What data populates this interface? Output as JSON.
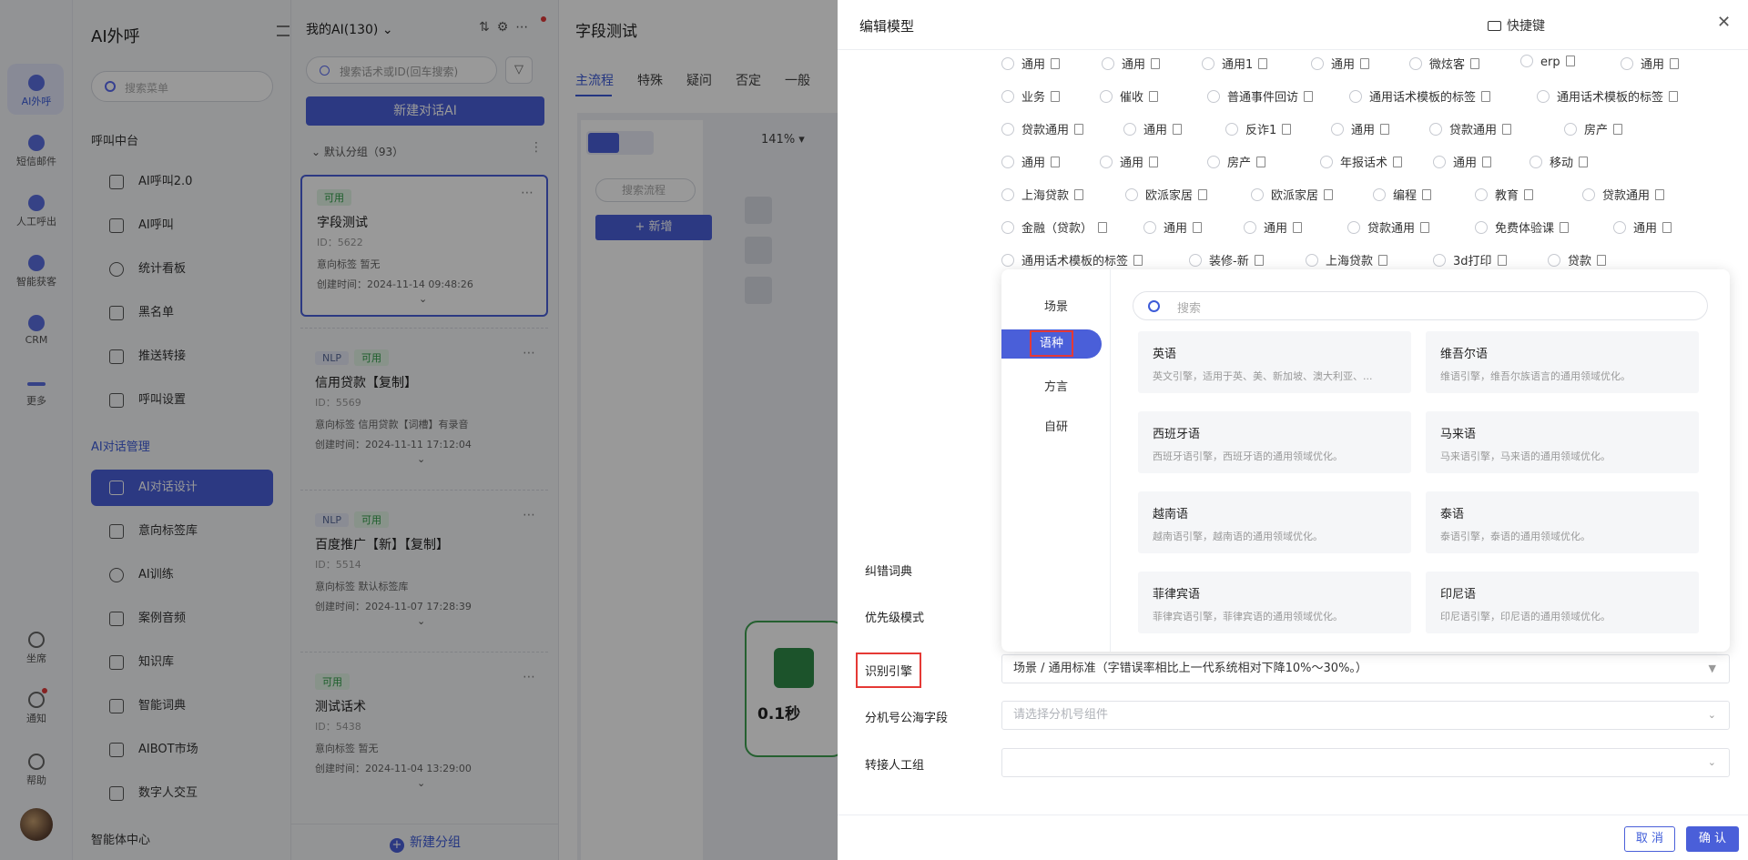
{
  "rail": {
    "items": [
      {
        "label": "AI外呼",
        "icon": "ai-call-icon"
      },
      {
        "label": "短信邮件",
        "icon": "message-icon"
      },
      {
        "label": "人工呼出",
        "icon": "phone-icon"
      },
      {
        "label": "智能获客",
        "icon": "target-icon"
      },
      {
        "label": "CRM",
        "icon": "crm-icon"
      },
      {
        "label": "更多",
        "icon": "more-icon"
      }
    ],
    "bottom": [
      {
        "label": "坐席",
        "icon": "headset-icon"
      },
      {
        "label": "通知",
        "icon": "bell-icon"
      },
      {
        "label": "帮助",
        "icon": "help-icon"
      }
    ]
  },
  "menu": {
    "title": "AI外呼",
    "search_placeholder": "搜索菜单",
    "section1": "呼叫中台",
    "section1_items": [
      "AI呼叫2.0",
      "AI呼叫",
      "统计看板",
      "黑名单",
      "推送转接",
      "呼叫设置"
    ],
    "section2": "AI对话管理",
    "section2_items": [
      "AI对话设计",
      "意向标签库",
      "AI训练",
      "案例音频",
      "知识库",
      "智能词典",
      "AIBOT市场",
      "数字人交互"
    ],
    "section3": "智能体中心"
  },
  "list": {
    "header": "我的AI(130)",
    "header_chevron": "⌄",
    "search_placeholder": "搜索话术或ID(回车搜索)",
    "new_button": "新建对话AI",
    "group": "默认分组（93）",
    "group_dots": "⋮",
    "cards": [
      {
        "badges": [
          "可用"
        ],
        "title": "字段测试",
        "id": "ID：5622",
        "tag": "意向标签    暂无",
        "time": "创建时间：2024-11-14 09:48:26"
      },
      {
        "badges": [
          "NLP",
          "可用"
        ],
        "title": "信用贷款【复制】",
        "id": "ID：5569",
        "tag": "意向标签    信用贷款【词槽】有录音",
        "time": "创建时间：2024-11-11 17:12:04"
      },
      {
        "badges": [
          "NLP",
          "可用"
        ],
        "title": "百度推广【新】【复制】",
        "id": "ID：5514",
        "tag": "意向标签    默认标签库",
        "time": "创建时间：2024-11-07 17:28:39"
      },
      {
        "badges": [
          "可用"
        ],
        "title": "测试话术",
        "id": "ID：5438",
        "tag": "意向标签    暂无",
        "time": "创建时间：2024-11-04 13:29:00"
      }
    ],
    "new_group": "新建分组"
  },
  "main": {
    "title": "字段测试",
    "tabs": [
      "主流程",
      "特殊",
      "疑问",
      "否定",
      "一般"
    ],
    "zoom": "141%",
    "flow_search_placeholder": "搜索流程",
    "new_flow": "+ 新增",
    "node_text": "0.1秒"
  },
  "drawer": {
    "title": "编辑模型",
    "shortcut": "快捷键",
    "close": "✕",
    "radio_rows": [
      [
        "通用",
        "通用",
        "通用1",
        "通用",
        "微炫客",
        "erp",
        "通用"
      ],
      [
        "业务",
        "催收",
        "普通事件回访",
        "通用话术模板的标签",
        "通用话术模板的标签"
      ],
      [
        "贷款通用",
        "通用",
        "反诈1",
        "通用",
        "贷款通用",
        "房产"
      ],
      [
        "通用",
        "通用",
        "房产",
        "年报话术",
        "通用",
        "移动"
      ],
      [
        "上海贷款",
        "欧派家居",
        "欧派家居",
        "编程",
        "教育",
        "贷款通用"
      ],
      [
        "金融（贷款）",
        "通用",
        "通用",
        "贷款通用",
        "免费体验课",
        "通用"
      ],
      [
        "通用话术模板的标签",
        "装修-新",
        "上海贷款",
        "3d打印",
        "贷款"
      ]
    ],
    "fields": {
      "correction_dict": "纠错词典",
      "priority_mode": "优先级模式",
      "engine_label": "识别引擎",
      "engine_value": "场景 / 通用标准（字错误率相比上一代系统相对下降10%～30%。）",
      "ext_label": "分机号公海字段",
      "ext_placeholder": "请选择分机号组件",
      "transfer_label": "转接人工组"
    },
    "popup": {
      "categories": [
        "场景",
        "语种",
        "方言",
        "自研"
      ],
      "active_category": "语种",
      "search_placeholder": "搜索",
      "options": [
        {
          "name": "英语",
          "desc": "英文引擎，适用于英、美、新加坡、澳大利亚、..."
        },
        {
          "name": "维吾尔语",
          "desc": "维语引擎，维吾尔族语言的通用领域优化。"
        },
        {
          "name": "西班牙语",
          "desc": "西班牙语引擎，西班牙语的通用领域优化。"
        },
        {
          "name": "马来语",
          "desc": "马来语引擎，马来语的通用领域优化。"
        },
        {
          "name": "越南语",
          "desc": "越南语引擎，越南语的通用领域优化。"
        },
        {
          "name": "泰语",
          "desc": "泰语引擎，泰语的通用领域优化。"
        },
        {
          "name": "菲律宾语",
          "desc": "菲律宾语引擎，菲律宾语的通用领域优化。"
        },
        {
          "name": "印尼语",
          "desc": "印尼语引擎，印尼语的通用领域优化。"
        }
      ]
    },
    "cancel": "取 消",
    "ok": "确 认"
  },
  "colors": {
    "primary": "#4a5fd9",
    "highlight": "#e53935",
    "success": "#2d9c46"
  }
}
